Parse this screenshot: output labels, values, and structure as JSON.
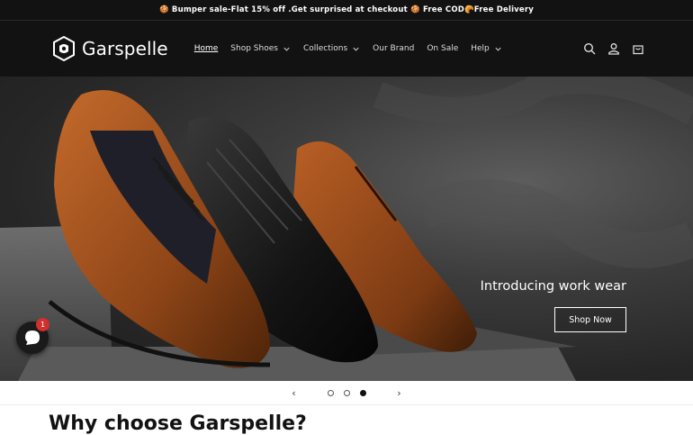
{
  "announcement": "🍪 Bumper sale-Flat 15% off .Get surprised at checkout 🍪 Free COD🥐Free Delivery",
  "brand": {
    "name": "Garspelle"
  },
  "nav": {
    "home": "Home",
    "shop_shoes": "Shop Shoes",
    "collections": "Collections",
    "our_brand": "Our Brand",
    "on_sale": "On Sale",
    "help": "Help"
  },
  "hero": {
    "title": "Introducing work wear",
    "button": "Shop Now"
  },
  "chat": {
    "badge_count": "1"
  },
  "slider": {
    "prev": "‹",
    "next": "›",
    "slides": 3,
    "active_slide": 3
  },
  "section": {
    "title": "Why choose Garspelle?"
  },
  "colors": {
    "header_bg": "#121212",
    "accent": "#ffffff",
    "badge": "#d0312d"
  }
}
